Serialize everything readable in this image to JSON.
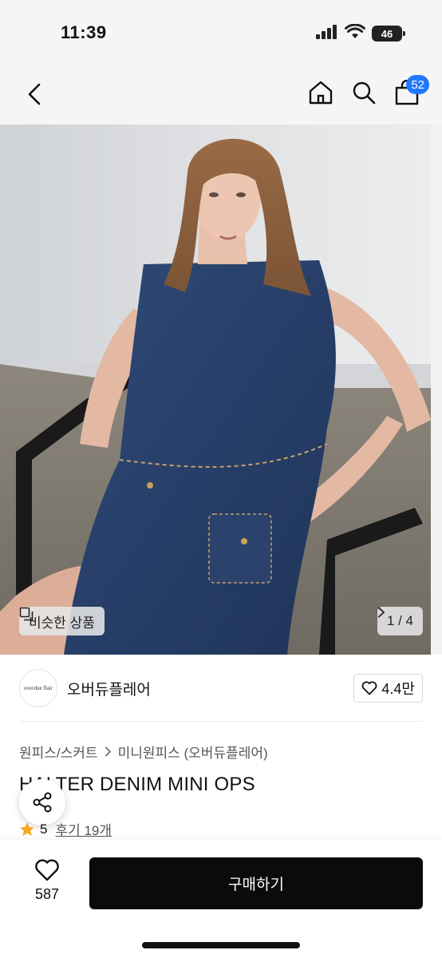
{
  "status": {
    "time": "11:39",
    "battery": "46"
  },
  "nav": {
    "cart_count": "52"
  },
  "gallery": {
    "similar_label": "비슷한 상품",
    "page_indicator": "1 / 4"
  },
  "brand": {
    "logo_text": "overdue flair",
    "name": "오버듀플레어",
    "likes": "4.4만"
  },
  "breadcrumb": {
    "category": "원피스/스커트",
    "subcategory": "미니원피스 (오버듀플레어)"
  },
  "product": {
    "title": "HALTER DENIM MINI OPS",
    "rating": "5",
    "review_text": "후기 19개"
  },
  "bottom": {
    "wish_count": "587",
    "buy_label": "구매하기"
  },
  "colors": {
    "badge": "#1f78ff",
    "buy_button": "#0b0b0b",
    "star": "#f5a623"
  }
}
